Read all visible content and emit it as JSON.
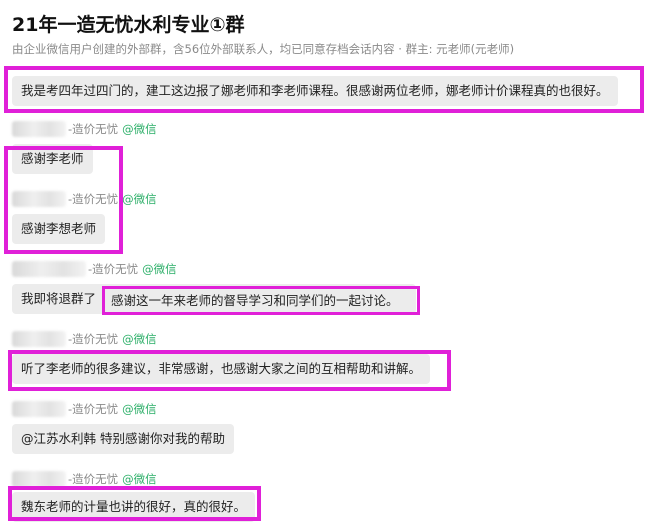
{
  "header": {
    "title": "21年一造无忧水利专业①群",
    "subtitle": "由企业微信用户创建的外部群，含56位外部联系人，均已同意存档会话内容 · 群主: 元老师(元老师)"
  },
  "messages": [
    {
      "sender_suffix": "",
      "app": "",
      "text": "我是考四年过四门的，建工这边报了娜老师和李老师课程。很感谢两位老师，娜老师计价课程真的也很好。"
    },
    {
      "sender_suffix": "-造价无忧",
      "app": "@微信",
      "text": "感谢李老师"
    },
    {
      "sender_suffix": "-造价无忧",
      "app": "@微信",
      "text": "感谢李想老师"
    },
    {
      "sender_suffix": "-造价无忧",
      "app": "@微信",
      "text": "我即将退群了",
      "highlight_text": "感谢这一年来老师的督导学习和同学们的一起讨论。"
    },
    {
      "sender_suffix": "-造价无忧",
      "app": "@微信",
      "text": "听了李老师的很多建议，非常感谢，也感谢大家之间的互相帮助和讲解。"
    },
    {
      "sender_suffix": "-造价无忧",
      "app": "@微信",
      "text": "@江苏水利韩  特别感谢你对我的帮助"
    },
    {
      "sender_suffix": "-造价无忧",
      "app": "@微信",
      "text": "魏东老师的计量也讲的很好，真的很好。"
    }
  ],
  "colors": {
    "highlight": "#e020d8",
    "wechat_green": "#2aae67",
    "bubble": "#ececec"
  }
}
